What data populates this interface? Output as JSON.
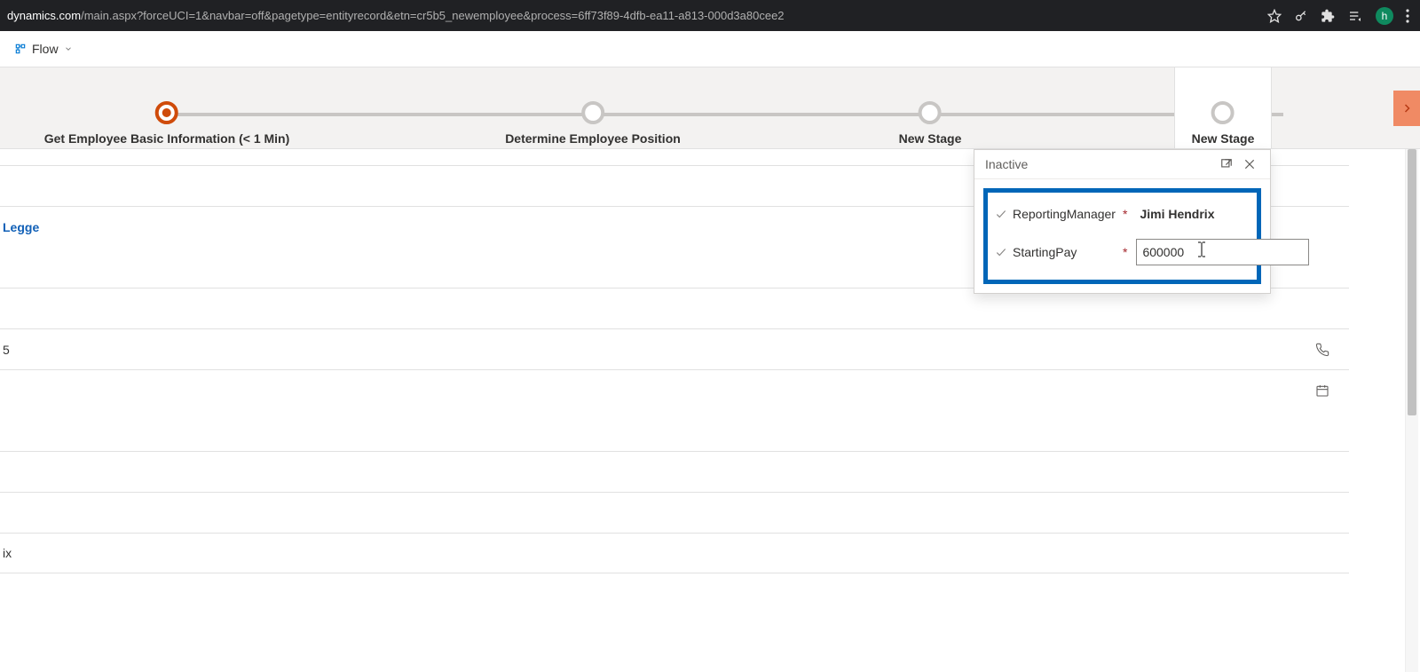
{
  "browser": {
    "url_domain": "dynamics.com",
    "url_path": "/main.aspx?forceUCI=1&navbar=off&pagetype=entityrecord&etn=cr5b5_newemployee&process=6ff73f89-4dfb-ea11-a813-000d3a80cee2",
    "avatar_letter": "h"
  },
  "commandbar": {
    "flow_label": "Flow"
  },
  "process": {
    "stages": [
      {
        "label": "Get Employee Basic Information  (< 1 Min)"
      },
      {
        "label": "Determine Employee Position"
      },
      {
        "label": "New Stage"
      },
      {
        "label": "New Stage"
      }
    ]
  },
  "flyout": {
    "status": "Inactive",
    "rows": [
      {
        "label": "ReportingManager",
        "value": "Jimi Hendrix"
      },
      {
        "label": "StartingPay",
        "value": "600000"
      }
    ]
  },
  "form": {
    "link_text": "Legge",
    "val1": "5",
    "val2": "ix"
  }
}
